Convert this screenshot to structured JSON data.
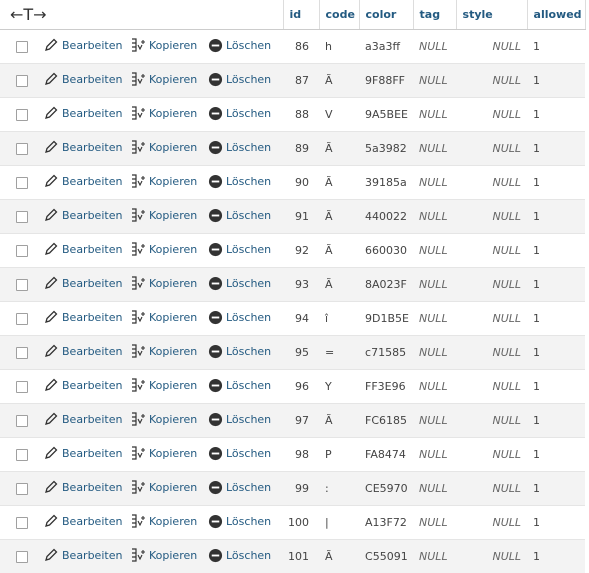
{
  "header": {
    "nav_arrows": "←T→",
    "columns": [
      "id",
      "code",
      "color",
      "tag",
      "style",
      "allowed"
    ]
  },
  "actions": {
    "edit": "Bearbeiten",
    "copy": "Kopieren",
    "delete": "Löschen"
  },
  "rows": [
    {
      "id": "86",
      "code": "h",
      "color": "a3a3ff",
      "tag": "NULL",
      "style": "NULL",
      "allowed": "1"
    },
    {
      "id": "87",
      "code": "Ã",
      "color": "9F88FF",
      "tag": "NULL",
      "style": "NULL",
      "allowed": "1"
    },
    {
      "id": "88",
      "code": "V",
      "color": "9A5BEE",
      "tag": "NULL",
      "style": "NULL",
      "allowed": "1"
    },
    {
      "id": "89",
      "code": "Ã",
      "color": "5a3982",
      "tag": "NULL",
      "style": "NULL",
      "allowed": "1"
    },
    {
      "id": "90",
      "code": "Ã",
      "color": "39185a",
      "tag": "NULL",
      "style": "NULL",
      "allowed": "1"
    },
    {
      "id": "91",
      "code": "Ã",
      "color": "440022",
      "tag": "NULL",
      "style": "NULL",
      "allowed": "1"
    },
    {
      "id": "92",
      "code": "Ã",
      "color": "660030",
      "tag": "NULL",
      "style": "NULL",
      "allowed": "1"
    },
    {
      "id": "93",
      "code": "Ã",
      "color": "8A023F",
      "tag": "NULL",
      "style": "NULL",
      "allowed": "1"
    },
    {
      "id": "94",
      "code": "î",
      "color": "9D1B5E",
      "tag": "NULL",
      "style": "NULL",
      "allowed": "1"
    },
    {
      "id": "95",
      "code": "=",
      "color": "c71585",
      "tag": "NULL",
      "style": "NULL",
      "allowed": "1"
    },
    {
      "id": "96",
      "code": "Y",
      "color": "FF3E96",
      "tag": "NULL",
      "style": "NULL",
      "allowed": "1"
    },
    {
      "id": "97",
      "code": "Ã",
      "color": "FC6185",
      "tag": "NULL",
      "style": "NULL",
      "allowed": "1"
    },
    {
      "id": "98",
      "code": "P",
      "color": "FA8474",
      "tag": "NULL",
      "style": "NULL",
      "allowed": "1"
    },
    {
      "id": "99",
      "code": ":",
      "color": "CE5970",
      "tag": "NULL",
      "style": "NULL",
      "allowed": "1"
    },
    {
      "id": "100",
      "code": "|",
      "color": "A13F72",
      "tag": "NULL",
      "style": "NULL",
      "allowed": "1"
    },
    {
      "id": "101",
      "code": "Ã",
      "color": "C55091",
      "tag": "NULL",
      "style": "NULL",
      "allowed": "1"
    }
  ]
}
